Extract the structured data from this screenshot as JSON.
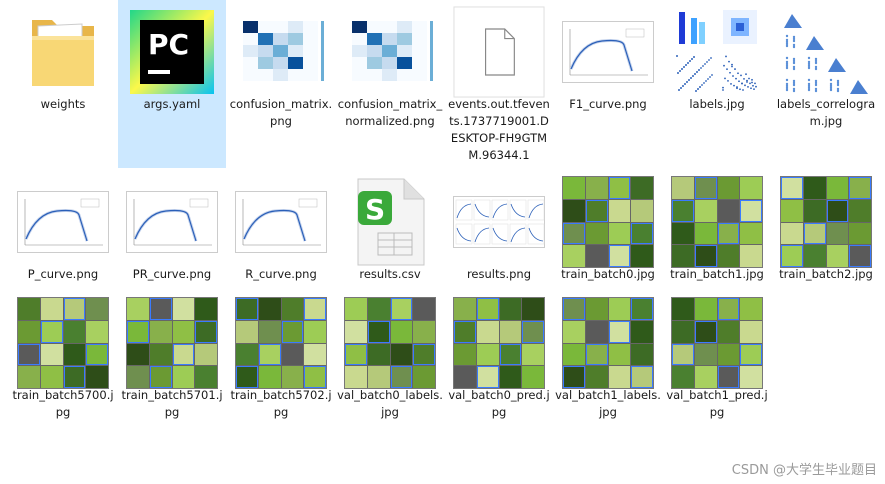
{
  "files": [
    {
      "name": "weights",
      "type": "folder",
      "selected": false
    },
    {
      "name": "args.yaml",
      "type": "pycharm",
      "selected": true
    },
    {
      "name": "confusion_matrix.png",
      "type": "confusion",
      "selected": false
    },
    {
      "name": "confusion_matrix_normalized.png",
      "type": "confusion",
      "selected": false
    },
    {
      "name": "events.out.tfevents.1737719001.DESKTOP-FH9GTMM.96344.1",
      "type": "blank",
      "selected": false
    },
    {
      "name": "F1_curve.png",
      "type": "curve",
      "selected": false
    },
    {
      "name": "labels.jpg",
      "type": "labels",
      "selected": false
    },
    {
      "name": "labels_correlogram.jpg",
      "type": "correlogram",
      "selected": false
    },
    {
      "name": "P_curve.png",
      "type": "curve",
      "selected": false
    },
    {
      "name": "PR_curve.png",
      "type": "curve",
      "selected": false
    },
    {
      "name": "R_curve.png",
      "type": "curve",
      "selected": false
    },
    {
      "name": "results.csv",
      "type": "csv",
      "selected": false
    },
    {
      "name": "results.png",
      "type": "results",
      "selected": false
    },
    {
      "name": "train_batch0.jpg",
      "type": "photo",
      "selected": false
    },
    {
      "name": "train_batch1.jpg",
      "type": "photo",
      "selected": false
    },
    {
      "name": "train_batch2.jpg",
      "type": "photo",
      "selected": false
    },
    {
      "name": "train_batch5700.jpg",
      "type": "photo",
      "selected": false
    },
    {
      "name": "train_batch5701.jpg",
      "type": "photo",
      "selected": false
    },
    {
      "name": "train_batch5702.jpg",
      "type": "photo",
      "selected": false
    },
    {
      "name": "val_batch0_labels.jpg",
      "type": "photo",
      "selected": false
    },
    {
      "name": "val_batch0_pred.jpg",
      "type": "photo",
      "selected": false
    },
    {
      "name": "val_batch1_labels.jpg",
      "type": "photo",
      "selected": false
    },
    {
      "name": "val_batch1_pred.jpg",
      "type": "photo",
      "selected": false
    }
  ],
  "watermark": "CSDN @大学生毕业题目",
  "colors": {
    "selection": "#cce8ff",
    "folder": "#f8d775",
    "pycharm_green": "#21d789",
    "csv_green": "#3aa93a",
    "plot_blue": "#2a5fb8"
  }
}
